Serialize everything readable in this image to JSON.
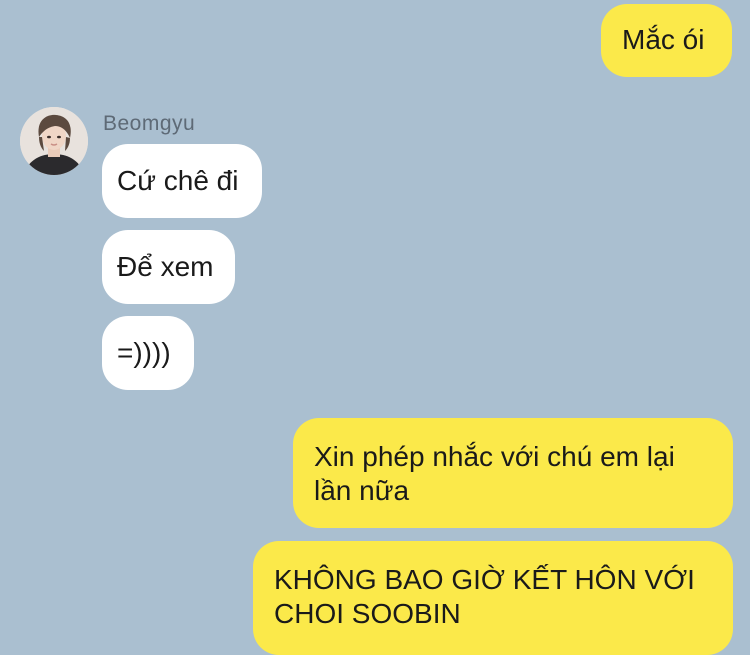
{
  "conversation": {
    "contact": {
      "name": "Beomgyu",
      "avatar_icon": "profile-photo"
    },
    "messages": [
      {
        "sender": "me",
        "text": "Mắc ói"
      },
      {
        "sender": "Beomgyu",
        "text": "Cứ chê đi"
      },
      {
        "sender": "Beomgyu",
        "text": "Để xem"
      },
      {
        "sender": "Beomgyu",
        "text": "=))))"
      },
      {
        "sender": "me",
        "text": "Xin phép nhắc với chú em lại lần nữa"
      },
      {
        "sender": "me",
        "text": "KHÔNG BAO GIỜ KẾT HÔN VỚI CHOI SOOBIN"
      }
    ]
  },
  "colors": {
    "background": "#aabfd0",
    "outgoing_bubble": "#fbe94a",
    "incoming_bubble": "#ffffff",
    "sender_name": "#5e6a76"
  }
}
